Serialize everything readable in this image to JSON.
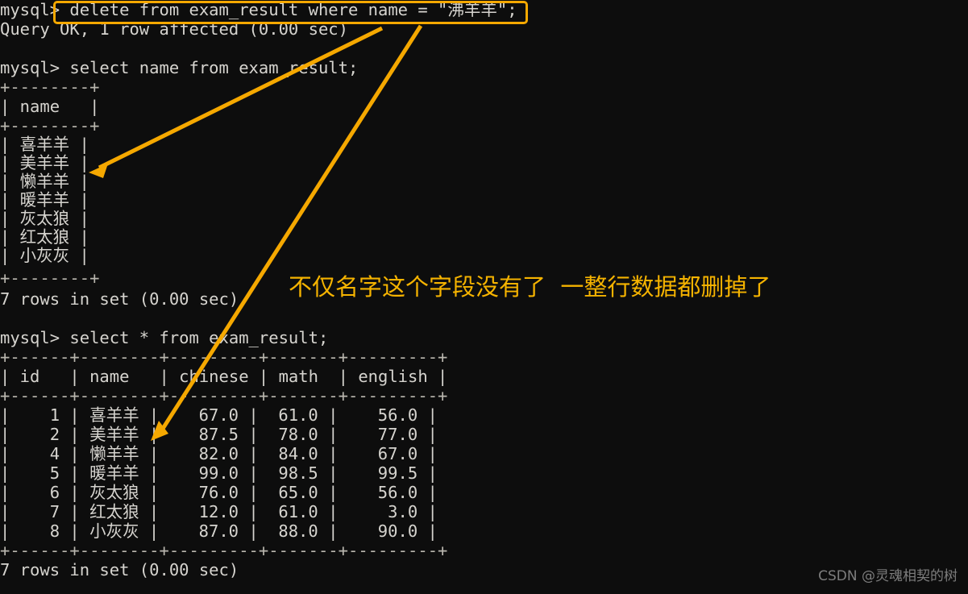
{
  "window": {
    "title": "MySQL command line terminal",
    "background_color": "#0d0d0d",
    "text_color": "#d6d4cf",
    "accent_color": "#f5a800"
  },
  "terminal": {
    "lines": [
      {
        "id": "l01",
        "text": "mysql> delete from exam_result where name = \"沸羊羊\";"
      },
      {
        "id": "l02",
        "text": "Query OK, 1 row affected (0.00 sec)"
      },
      {
        "id": "l03",
        "text": ""
      },
      {
        "id": "l04",
        "text": "mysql> select name from exam_result;"
      },
      {
        "id": "l05",
        "text": "+--------+"
      },
      {
        "id": "l06",
        "text": "| name   |"
      },
      {
        "id": "l07",
        "text": "+--------+"
      },
      {
        "id": "l08",
        "text": "| 喜羊羊 |"
      },
      {
        "id": "l09",
        "text": "| 美羊羊 |"
      },
      {
        "id": "l10",
        "text": "| 懒羊羊 |"
      },
      {
        "id": "l11",
        "text": "| 暖羊羊 |"
      },
      {
        "id": "l12",
        "text": "| 灰太狼 |"
      },
      {
        "id": "l13",
        "text": "| 红太狼 |"
      },
      {
        "id": "l14",
        "text": "| 小灰灰 |"
      },
      {
        "id": "l15",
        "text": "+--------+"
      },
      {
        "id": "l16",
        "text": "7 rows in set (0.00 sec)"
      },
      {
        "id": "l17",
        "text": ""
      },
      {
        "id": "l18",
        "text": "mysql> select * from exam_result;"
      },
      {
        "id": "l19",
        "text": "+------+--------+---------+-------+---------+"
      },
      {
        "id": "l20",
        "text": "| id   | name   | chinese | math  | english |"
      },
      {
        "id": "l21",
        "text": "+------+--------+---------+-------+---------+"
      },
      {
        "id": "l22",
        "text": "|    1 | 喜羊羊 |    67.0 |  61.0 |    56.0 |"
      },
      {
        "id": "l23",
        "text": "|    2 | 美羊羊 |    87.5 |  78.0 |    77.0 |"
      },
      {
        "id": "l24",
        "text": "|    4 | 懒羊羊 |    82.0 |  84.0 |    67.0 |"
      },
      {
        "id": "l25",
        "text": "|    5 | 暖羊羊 |    99.0 |  98.5 |    99.5 |"
      },
      {
        "id": "l26",
        "text": "|    6 | 灰太狼 |    76.0 |  65.0 |    56.0 |"
      },
      {
        "id": "l27",
        "text": "|    7 | 红太狼 |    12.0 |  61.0 |     3.0 |"
      },
      {
        "id": "l28",
        "text": "|    8 | 小灰灰 |    87.0 |  88.0 |    90.0 |"
      },
      {
        "id": "l29",
        "text": "+------+--------+---------+-------+---------+"
      },
      {
        "id": "l30",
        "text": "7 rows in set (0.00 sec)"
      }
    ],
    "commands": {
      "delete_statement": "delete from exam_result where name = \"沸羊羊\";",
      "delete_result": "Query OK, 1 row affected (0.00 sec)",
      "select_name": "select name from exam_result;",
      "select_all": "select * from exam_result;",
      "prompt": "mysql>",
      "rows_in_set": "7 rows in set (0.00 sec)"
    },
    "name_table": {
      "columns": [
        "name"
      ],
      "rows": [
        [
          "喜羊羊"
        ],
        [
          "美羊羊"
        ],
        [
          "懒羊羊"
        ],
        [
          "暖羊羊"
        ],
        [
          "灰太狼"
        ],
        [
          "红太狼"
        ],
        [
          "小灰灰"
        ]
      ],
      "footer": "7 rows in set (0.00 sec)"
    },
    "result_table": {
      "columns": [
        "id",
        "name",
        "chinese",
        "math",
        "english"
      ],
      "rows": [
        [
          "1",
          "喜羊羊",
          "67.0",
          "61.0",
          "56.0"
        ],
        [
          "2",
          "美羊羊",
          "87.5",
          "78.0",
          "77.0"
        ],
        [
          "4",
          "懒羊羊",
          "82.0",
          "84.0",
          "67.0"
        ],
        [
          "5",
          "暖羊羊",
          "99.0",
          "98.5",
          "99.5"
        ],
        [
          "6",
          "灰太狼",
          "76.0",
          "65.0",
          "56.0"
        ],
        [
          "7",
          "红太狼",
          "12.0",
          "61.0",
          "3.0"
        ],
        [
          "8",
          "小灰灰",
          "87.0",
          "88.0",
          "90.0"
        ]
      ],
      "footer": "7 rows in set (0.00 sec)"
    }
  },
  "annotations": {
    "highlight_box_label": "delete statement highlight",
    "note_text": "不仅名字这个字段没有了  一整行数据都删掉了",
    "note_color": "#f5b300",
    "arrow_color": "#f5a800",
    "arrow_1_label": "arrow to name column values",
    "arrow_2_label": "arrow to full row values"
  },
  "watermark": {
    "text": "CSDN @灵魂相契的树"
  }
}
